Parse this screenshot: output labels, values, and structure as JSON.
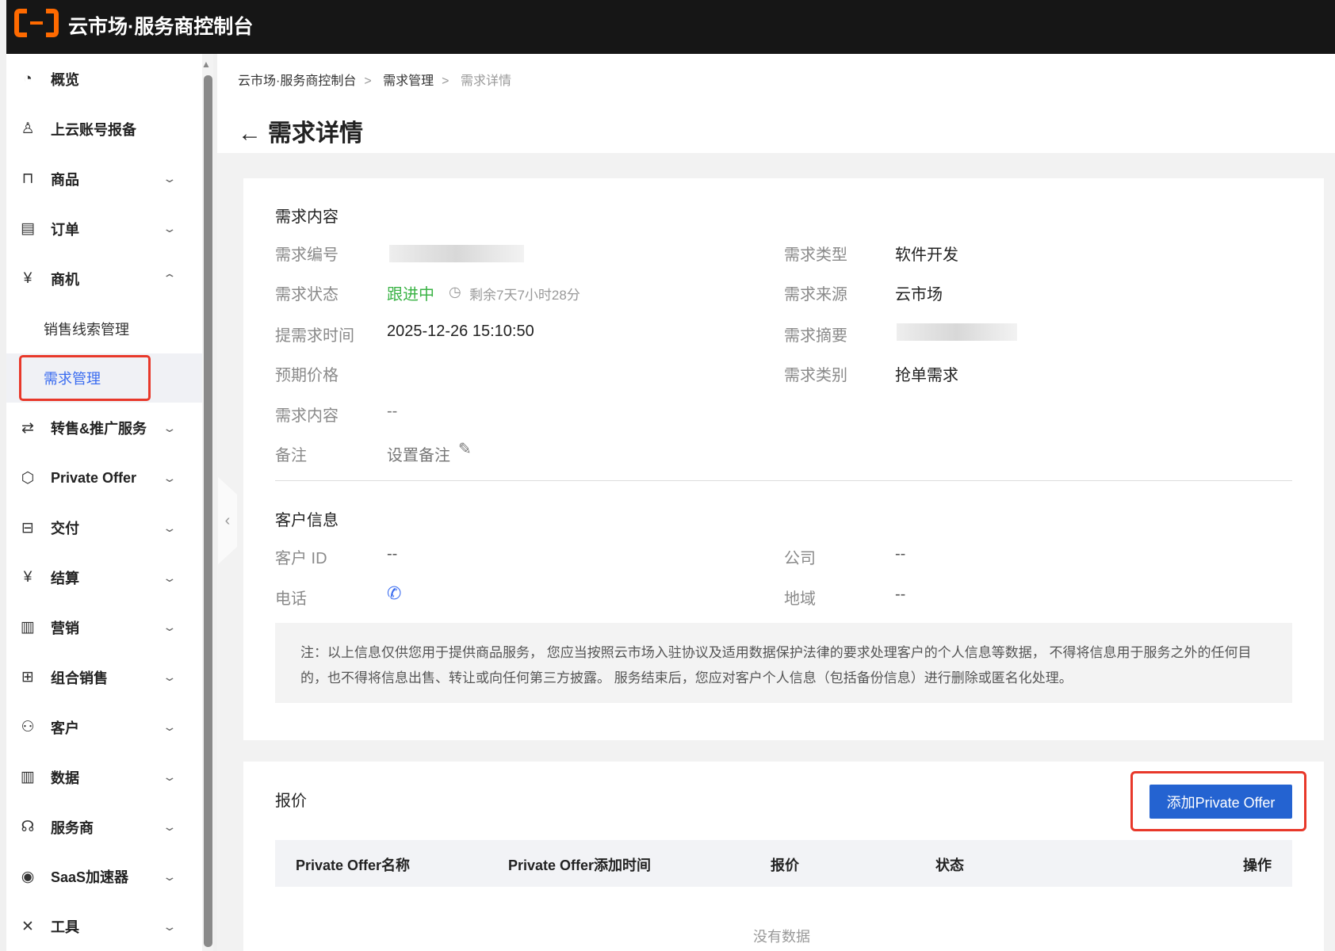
{
  "header": {
    "title": "云市场·服务商控制台",
    "logo_color": "#ff6a00"
  },
  "sidebar": {
    "items": [
      {
        "label": "概览",
        "icon": "pie-chart-icon",
        "glyph": "◔"
      },
      {
        "label": "上云账号报备",
        "icon": "user-icon",
        "glyph": "♙"
      },
      {
        "label": "商品",
        "icon": "bag-icon",
        "glyph": "⊓",
        "chevron": "﹀"
      },
      {
        "label": "订单",
        "icon": "order-icon",
        "glyph": "▤",
        "chevron": "﹀"
      },
      {
        "label": "商机",
        "icon": "opportunity-icon",
        "glyph": "¥",
        "chevron": "︿"
      },
      {
        "label": "销售线索管理",
        "sub": true
      },
      {
        "label": "需求管理",
        "sub": true,
        "active": true
      },
      {
        "label": "转售&推广服务",
        "icon": "swap-icon",
        "glyph": "⇄",
        "chevron": "﹀"
      },
      {
        "label": "Private Offer",
        "icon": "cube-icon",
        "glyph": "⬡",
        "chevron": "﹀"
      },
      {
        "label": "交付",
        "icon": "delivery-icon",
        "glyph": "⊟",
        "chevron": "﹀"
      },
      {
        "label": "结算",
        "icon": "yen-circle-icon",
        "glyph": "¥",
        "chevron": "﹀"
      },
      {
        "label": "营销",
        "icon": "marketing-icon",
        "glyph": "▥",
        "chevron": "﹀"
      },
      {
        "label": "组合销售",
        "icon": "grid-plus-icon",
        "glyph": "⊞",
        "chevron": "﹀"
      },
      {
        "label": "客户",
        "icon": "users-icon",
        "glyph": "⚇",
        "chevron": "﹀"
      },
      {
        "label": "数据",
        "icon": "bar-chart-icon",
        "glyph": "▥",
        "chevron": "﹀"
      },
      {
        "label": "服务商",
        "icon": "headset-icon",
        "glyph": "☊",
        "chevron": "﹀"
      },
      {
        "label": "SaaS加速器",
        "icon": "accelerator-icon",
        "glyph": "◉",
        "chevron": "﹀"
      },
      {
        "label": "工具",
        "icon": "tools-icon",
        "glyph": "✕",
        "chevron": "﹀"
      }
    ]
  },
  "breadcrumb": [
    "云市场·服务商控制台",
    "需求管理",
    "需求详情"
  ],
  "page_title": "需求详情",
  "demand": {
    "section": "需求内容",
    "fields_left": [
      {
        "label": "需求编号",
        "value": ""
      },
      {
        "label": "需求状态",
        "value": "跟进中",
        "extra": "剩余7天7小时28分"
      },
      {
        "label": "提需求时间",
        "value": "2025-12-26 15:10:50"
      },
      {
        "label": "预期价格",
        "value": ""
      },
      {
        "label": "需求内容",
        "value": "--"
      },
      {
        "label": "备注",
        "value": "设置备注"
      }
    ],
    "fields_right": [
      {
        "label": "需求类型",
        "value": "软件开发"
      },
      {
        "label": "需求来源",
        "value": "云市场"
      },
      {
        "label": "需求摘要",
        "value": ""
      },
      {
        "label": "需求类别",
        "value": "抢单需求"
      }
    ],
    "status_color": "#3bb346"
  },
  "customer": {
    "section": "客户信息",
    "fields": [
      {
        "label": "客户 ID",
        "value": "--"
      },
      {
        "label": "电话",
        "value": ""
      },
      {
        "label": "公司",
        "value": "--"
      },
      {
        "label": "地域",
        "value": "--"
      }
    ],
    "note": "注：以上信息仅供您用于提供商品服务， 您应当按照云市场入驻协议及适用数据保护法律的要求处理客户的个人信息等数据， 不得将信息用于服务之外的任何目的，也不得将信息出售、转让或向任何第三方披露。 服务结束后，您应对客户个人信息（包括备份信息）进行删除或匿名化处理。"
  },
  "quote": {
    "section": "报价",
    "add_button": "添加Private Offer",
    "columns": [
      "Private Offer名称",
      "Private Offer添加时间",
      "报价",
      "状态",
      "操作"
    ],
    "empty": "没有数据"
  }
}
